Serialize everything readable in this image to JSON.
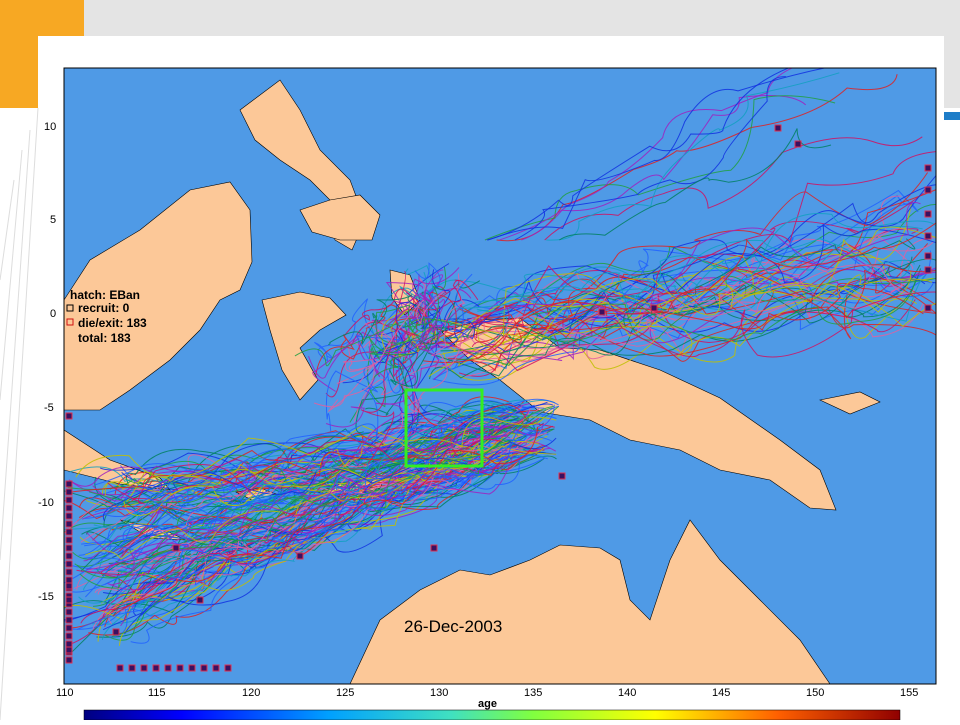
{
  "slide": {
    "accent_color": "#f7a823",
    "header_band_color": "#e4e4e4",
    "blue_marker_color": "#1e7dc8"
  },
  "map": {
    "ocean_color": "#4f9ae6",
    "land_color": "#fcc898",
    "x_ticks": [
      "110",
      "115",
      "120",
      "125",
      "130",
      "135",
      "140",
      "145",
      "150",
      "155"
    ],
    "y_ticks": [
      "10",
      "5",
      "0",
      "-5",
      "-10",
      "-15"
    ],
    "date": "26-Dec-2003",
    "legend": {
      "hatch": "hatch: EBan",
      "recruit": "recruit:    0",
      "die_exit": "die/exit: 183",
      "total": "total:     183"
    },
    "colorbar_label": "age",
    "study_box_color": "#33ee22"
  }
}
